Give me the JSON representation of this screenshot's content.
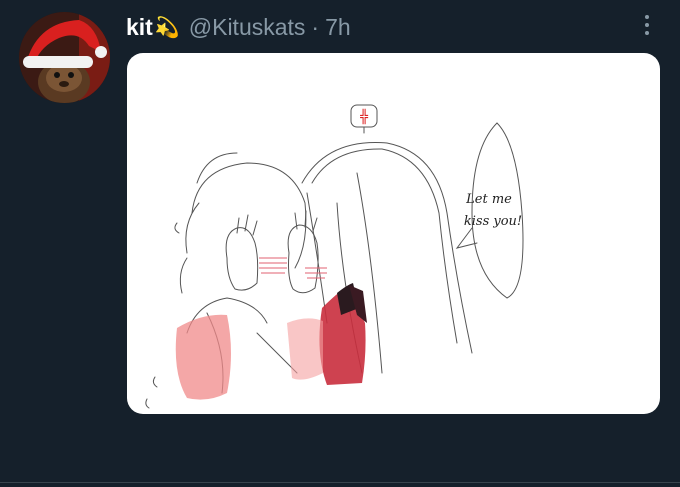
{
  "tweet": {
    "display_name": "kit",
    "name_emoji": "💫",
    "handle": "@Kituskats",
    "separator": "·",
    "timestamp": "7h"
  },
  "media": {
    "speech_line1": "Let me",
    "speech_line2": "kiss you!",
    "anger_symbol": "╬"
  },
  "colors": {
    "background": "#15202b",
    "secondary_text": "#8899a6",
    "primary_text": "#ffffff"
  },
  "icons": [
    "avatar-image",
    "more-options-icon"
  ]
}
